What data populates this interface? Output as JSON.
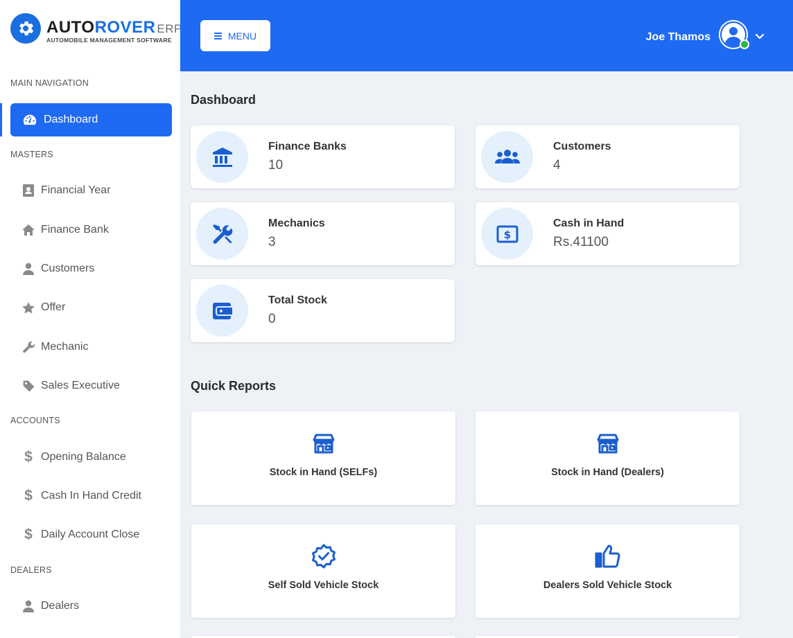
{
  "brand": {
    "auto": "AUTO",
    "rover": "ROVER",
    "erp": "ERP",
    "subtitle": "AUTOMOBILE MANAGEMENT SOFTWARE",
    "color": "#1a6fe0"
  },
  "sidebar": {
    "sections": {
      "main": "MAIN NAVIGATION",
      "masters": "MASTERS",
      "accounts": "ACCOUNTS",
      "dealers": "DEALERS"
    },
    "items": {
      "dashboard": "Dashboard",
      "financial_year": "Financial Year",
      "finance_bank": "Finance Bank",
      "customers": "Customers",
      "offer": "Offer",
      "mechanic": "Mechanic",
      "sales_executive": "Sales Executive",
      "opening_balance": "Opening Balance",
      "cash_in_hand_credit": "Cash In Hand Credit",
      "daily_account_close": "Daily Account Close",
      "dealers": "Dealers"
    },
    "active_color": "#1e6af2"
  },
  "header": {
    "menu_label": "MENU",
    "user_name": "Joe Thamos",
    "online_status_color": "#2cb34a"
  },
  "dashboard": {
    "title": "Dashboard",
    "stats": {
      "finance_banks": {
        "label": "Finance Banks",
        "value": "10",
        "icon": "bank-icon"
      },
      "customers": {
        "label": "Customers",
        "value": "4",
        "icon": "users-icon"
      },
      "mechanics": {
        "label": "Mechanics",
        "value": "3",
        "icon": "tools-icon"
      },
      "cash_in_hand": {
        "label": "Cash in Hand",
        "value": "Rs.41100",
        "icon": "money-icon"
      },
      "total_stock": {
        "label": "Total Stock",
        "value": "0",
        "icon": "wallet-icon"
      }
    }
  },
  "quick_reports": {
    "title": "Quick Reports",
    "items": {
      "stock_selfs": {
        "label": "Stock in Hand (SELFs)",
        "icon": "store-icon"
      },
      "stock_dealers": {
        "label": "Stock in Hand (Dealers)",
        "icon": "store-icon"
      },
      "self_sold": {
        "label": "Self Sold Vehicle Stock",
        "icon": "verified-badge-icon"
      },
      "dealers_sold": {
        "label": "Dealers Sold Vehicle Stock",
        "icon": "thumbs-up-icon"
      }
    }
  }
}
